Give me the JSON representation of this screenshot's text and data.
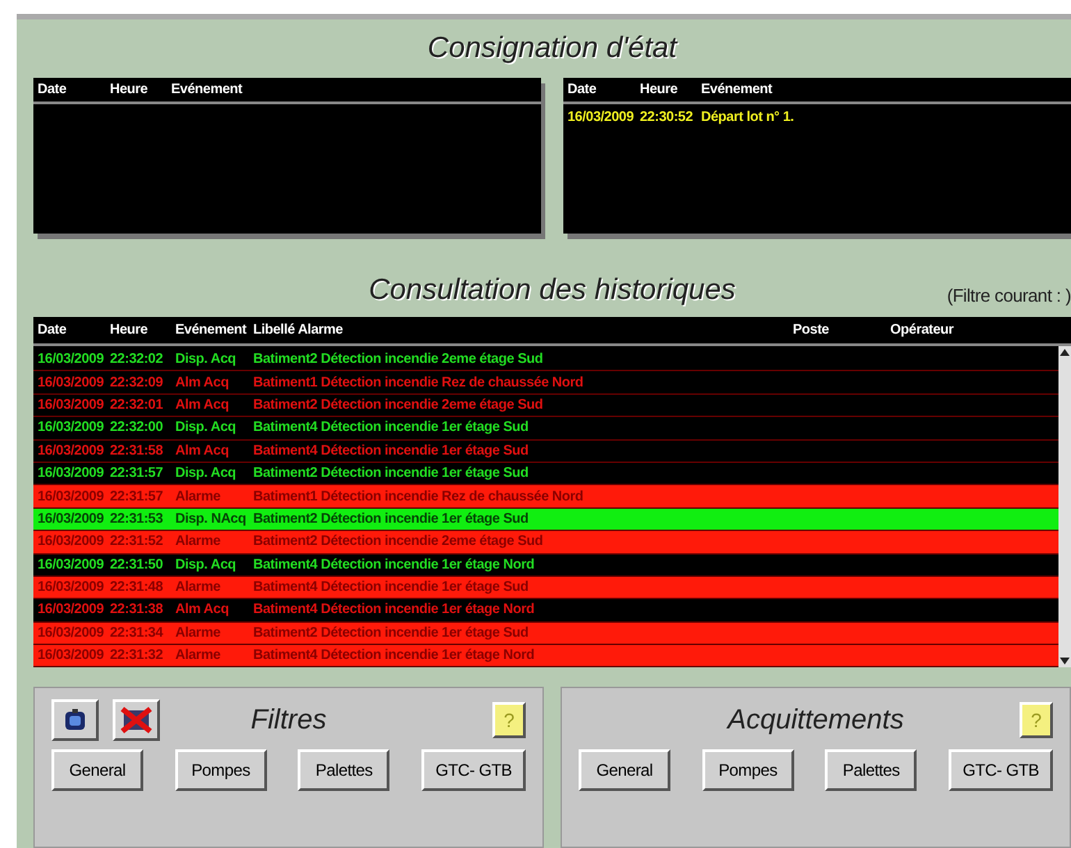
{
  "consignation": {
    "title": "Consignation d'état",
    "panels": [
      {
        "columns": [
          "Date",
          "Heure",
          "Evénement"
        ]
      },
      {
        "columns": [
          "Date",
          "Heure",
          "Evénement"
        ],
        "rows": [
          [
            "16/03/2009",
            "22:30:52",
            "Départ lot n°  1."
          ]
        ]
      }
    ]
  },
  "historiques": {
    "title": "Consultation des historiques",
    "filter_label": "(Filtre courant : )",
    "columns": [
      "Date",
      "Heure",
      "Evénement",
      "Libellé Alarme",
      "Poste",
      "Opérateur"
    ],
    "rows": [
      {
        "kind": "cleared",
        "cells": [
          "16/03/2009",
          "22:32:02",
          "Disp. Acq",
          "Batiment2  Détection incendie 2eme étage Sud"
        ]
      },
      {
        "kind": "acked",
        "cells": [
          "16/03/2009",
          "22:32:09",
          "Alm Acq",
          "Batiment1  Détection incendie Rez de chaussée Nord"
        ]
      },
      {
        "kind": "acked",
        "cells": [
          "16/03/2009",
          "22:32:01",
          "Alm Acq",
          "Batiment2  Détection incendie 2eme étage Sud"
        ]
      },
      {
        "kind": "cleared",
        "cells": [
          "16/03/2009",
          "22:32:00",
          "Disp. Acq",
          "Batiment4  Détection incendie 1er étage Sud"
        ]
      },
      {
        "kind": "acked",
        "cells": [
          "16/03/2009",
          "22:31:58",
          "Alm Acq",
          "Batiment4  Détection incendie 1er étage Sud"
        ]
      },
      {
        "kind": "cleared",
        "cells": [
          "16/03/2009",
          "22:31:57",
          "Disp. Acq",
          "Batiment2  Détection incendie 1er étage Sud"
        ]
      },
      {
        "kind": "alarm",
        "cells": [
          "16/03/2009",
          "22:31:57",
          "Alarme",
          "Batiment1  Détection incendie Rez de chaussée Nord"
        ]
      },
      {
        "kind": "unacked",
        "cells": [
          "16/03/2009",
          "22:31:53",
          "Disp. NAcq",
          "Batiment2  Détection incendie 1er étage Sud"
        ]
      },
      {
        "kind": "alarm",
        "cells": [
          "16/03/2009",
          "22:31:52",
          "Alarme",
          "Batiment2  Détection incendie 2eme étage Sud"
        ]
      },
      {
        "kind": "cleared",
        "cells": [
          "16/03/2009",
          "22:31:50",
          "Disp. Acq",
          "Batiment4  Détection incendie 1er étage Nord"
        ]
      },
      {
        "kind": "alarm",
        "cells": [
          "16/03/2009",
          "22:31:48",
          "Alarme",
          "Batiment4  Détection incendie 1er étage Sud"
        ]
      },
      {
        "kind": "acked",
        "cells": [
          "16/03/2009",
          "22:31:38",
          "Alm Acq",
          "Batiment4  Détection incendie 1er étage Nord"
        ]
      },
      {
        "kind": "alarm",
        "cells": [
          "16/03/2009",
          "22:31:34",
          "Alarme",
          "Batiment2  Détection incendie 1er étage Sud"
        ]
      },
      {
        "kind": "alarm",
        "cells": [
          "16/03/2009",
          "22:31:32",
          "Alarme",
          "Batiment4  Détection incendie 1er étage Nord"
        ]
      }
    ]
  },
  "filtres": {
    "title": "Filtres",
    "help": "?",
    "buttons": [
      "General",
      "Pompes",
      "Palettes",
      "GTC- GTB"
    ]
  },
  "acquittements": {
    "title": "Acquittements",
    "help": "?",
    "buttons": [
      "General",
      "Pompes",
      "Palettes",
      "GTC- GTB"
    ]
  }
}
